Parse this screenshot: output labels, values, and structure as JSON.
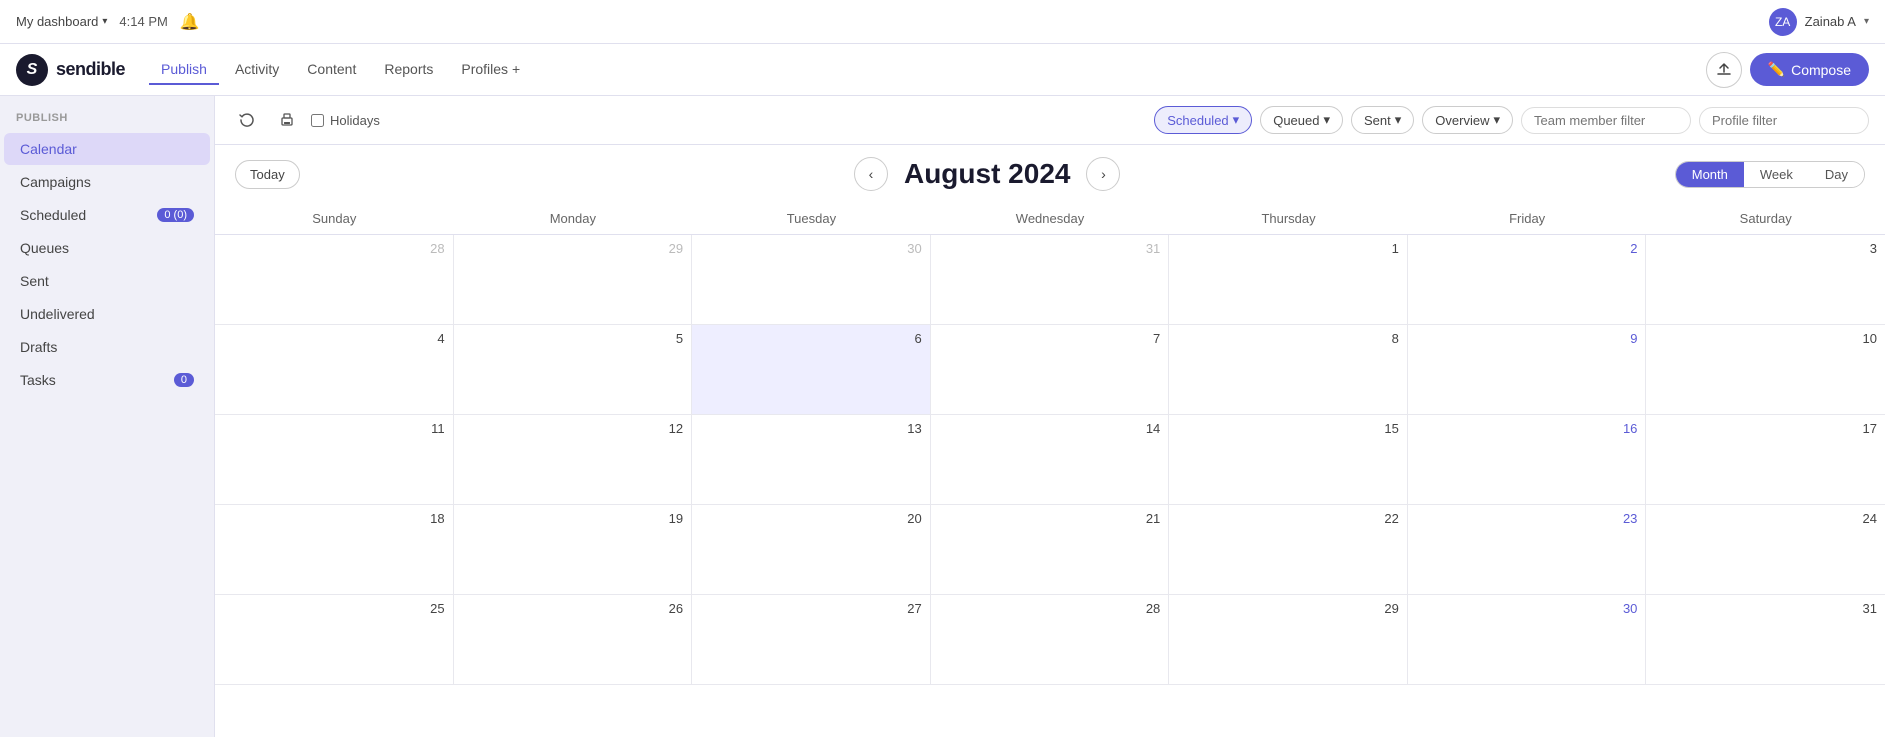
{
  "topbar": {
    "dashboard_label": "My dashboard",
    "time": "4:14 PM",
    "user_name": "Zainab A",
    "user_initials": "ZA"
  },
  "navbar": {
    "logo_text": "sendible",
    "nav_items": [
      {
        "id": "publish",
        "label": "Publish",
        "active": true
      },
      {
        "id": "activity",
        "label": "Activity",
        "active": false
      },
      {
        "id": "content",
        "label": "Content",
        "active": false
      },
      {
        "id": "reports",
        "label": "Reports",
        "active": false
      },
      {
        "id": "profiles",
        "label": "Profiles +",
        "active": false
      }
    ],
    "compose_label": "Compose"
  },
  "sidebar": {
    "section_title": "PUBLISH",
    "items": [
      {
        "id": "calendar",
        "label": "Calendar",
        "active": true,
        "badge": null
      },
      {
        "id": "campaigns",
        "label": "Campaigns",
        "active": false,
        "badge": null
      },
      {
        "id": "scheduled",
        "label": "Scheduled",
        "active": false,
        "badge": "0 (0)"
      },
      {
        "id": "queues",
        "label": "Queues",
        "active": false,
        "badge": null
      },
      {
        "id": "sent",
        "label": "Sent",
        "active": false,
        "badge": null
      },
      {
        "id": "undelivered",
        "label": "Undelivered",
        "active": false,
        "badge": null
      },
      {
        "id": "drafts",
        "label": "Drafts",
        "active": false,
        "badge": null
      },
      {
        "id": "tasks",
        "label": "Tasks",
        "active": false,
        "badge": "0"
      }
    ]
  },
  "toolbar": {
    "holidays_label": "Holidays",
    "filters": [
      {
        "id": "scheduled",
        "label": "Scheduled",
        "active": true,
        "has_chevron": true
      },
      {
        "id": "queued",
        "label": "Queued",
        "active": false,
        "has_chevron": true
      },
      {
        "id": "sent",
        "label": "Sent",
        "active": false,
        "has_chevron": true
      },
      {
        "id": "overview",
        "label": "Overview",
        "active": false,
        "has_chevron": true
      }
    ],
    "team_member_placeholder": "Team member filter",
    "profile_placeholder": "Profile filter"
  },
  "calendar": {
    "month_year": "August 2024",
    "today_label": "Today",
    "view_options": [
      {
        "id": "month",
        "label": "Month",
        "active": true
      },
      {
        "id": "week",
        "label": "Week",
        "active": false
      },
      {
        "id": "day",
        "label": "Day",
        "active": false
      }
    ],
    "day_headers": [
      "Sunday",
      "Monday",
      "Tuesday",
      "Wednesday",
      "Thursday",
      "Friday",
      "Saturday"
    ],
    "weeks": [
      [
        {
          "num": "28",
          "other": true,
          "today": false
        },
        {
          "num": "29",
          "other": true,
          "today": false
        },
        {
          "num": "30",
          "other": true,
          "today": false
        },
        {
          "num": "31",
          "other": true,
          "today": false
        },
        {
          "num": "1",
          "other": false,
          "today": false
        },
        {
          "num": "2",
          "other": false,
          "today": false
        },
        {
          "num": "3",
          "other": false,
          "today": false
        }
      ],
      [
        {
          "num": "4",
          "other": false,
          "today": false
        },
        {
          "num": "5",
          "other": false,
          "today": false
        },
        {
          "num": "6",
          "other": false,
          "today": true
        },
        {
          "num": "7",
          "other": false,
          "today": false
        },
        {
          "num": "8",
          "other": false,
          "today": false
        },
        {
          "num": "9",
          "other": false,
          "today": false
        },
        {
          "num": "10",
          "other": false,
          "today": false
        }
      ],
      [
        {
          "num": "11",
          "other": false,
          "today": false
        },
        {
          "num": "12",
          "other": false,
          "today": false
        },
        {
          "num": "13",
          "other": false,
          "today": false
        },
        {
          "num": "14",
          "other": false,
          "today": false
        },
        {
          "num": "15",
          "other": false,
          "today": false
        },
        {
          "num": "16",
          "other": false,
          "today": false
        },
        {
          "num": "17",
          "other": false,
          "today": false
        }
      ]
    ]
  },
  "colors": {
    "accent": "#5b5bd6",
    "today_bg": "#eeeeff"
  }
}
